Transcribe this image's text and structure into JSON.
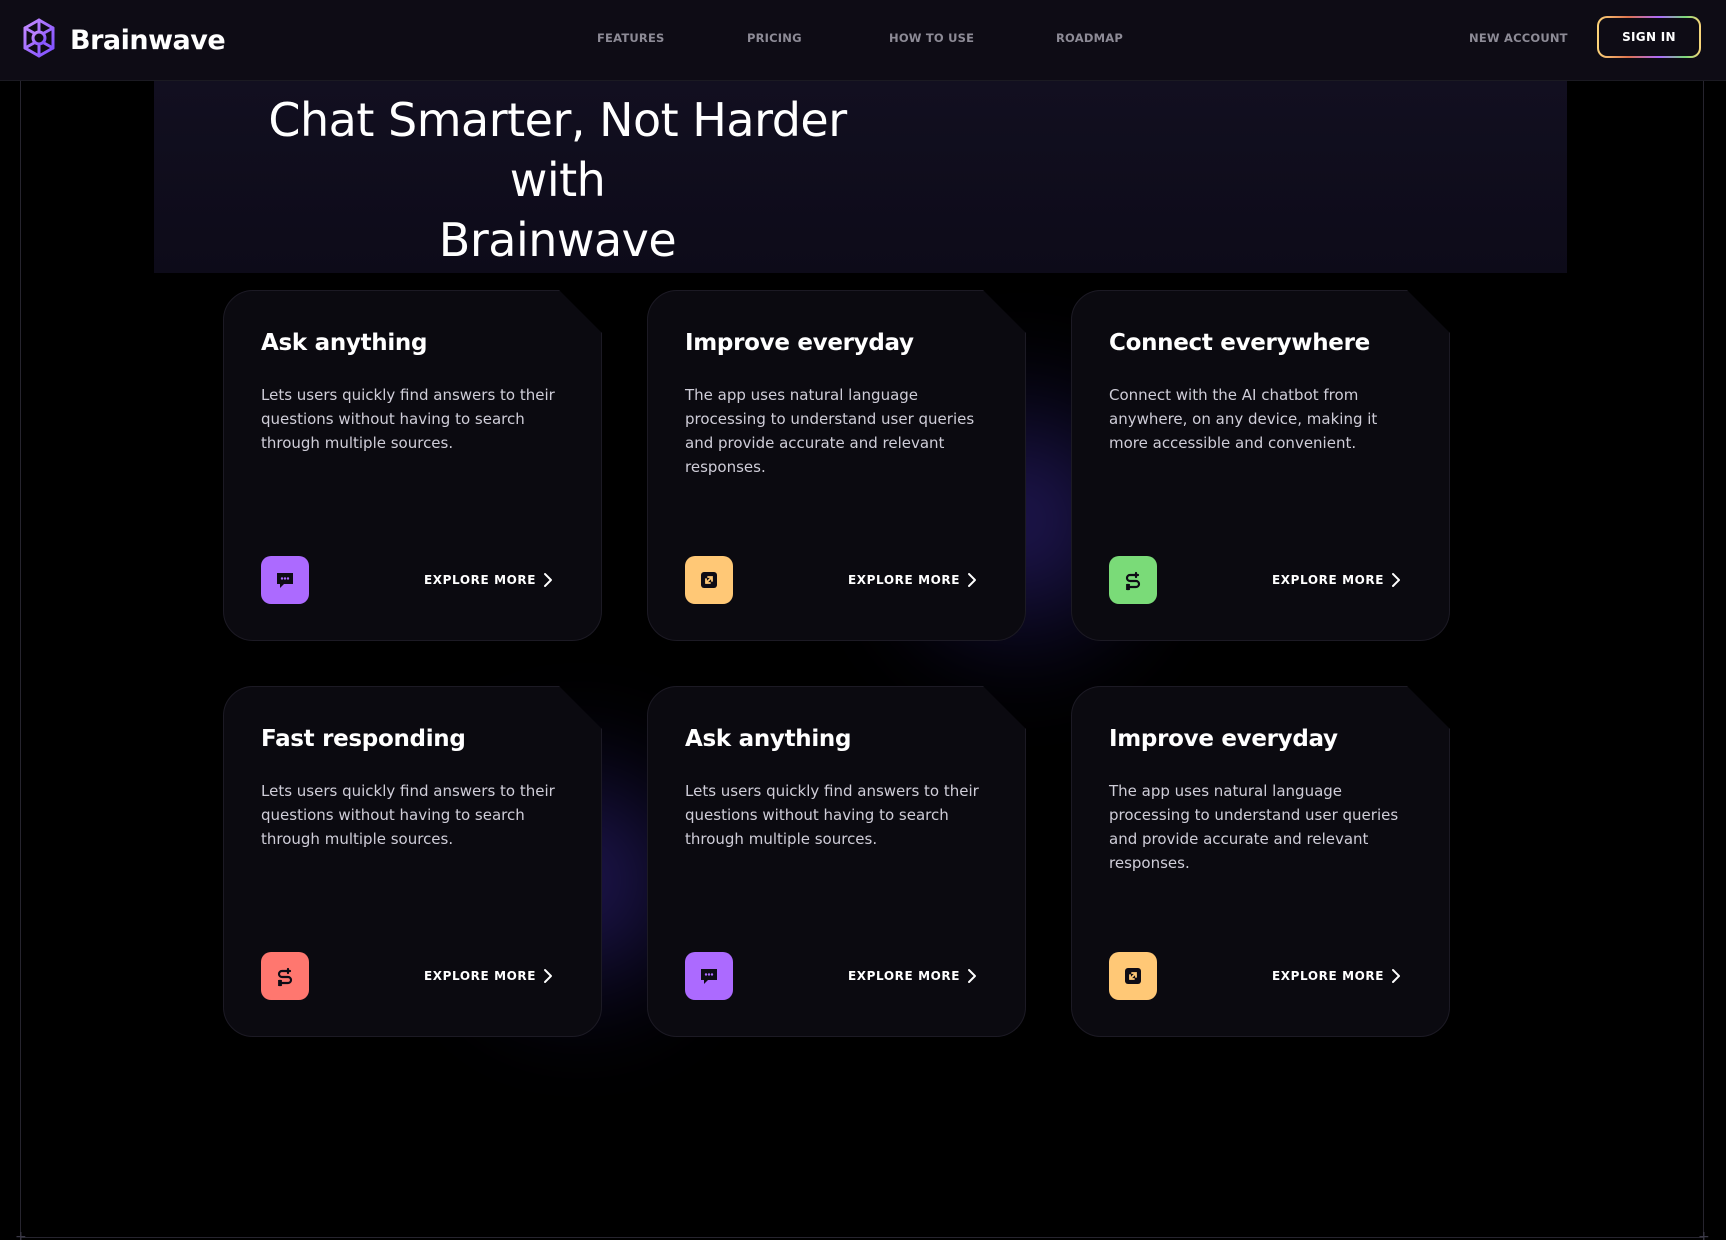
{
  "brand": {
    "name": "Brainwave",
    "logo_icon": "brain-icon"
  },
  "nav": {
    "items": [
      "FEATURES",
      "PRICING",
      "HOW TO USE",
      "ROADMAP"
    ],
    "new_account": "NEW ACCOUNT",
    "sign_in": "SIGN IN"
  },
  "hero": {
    "title_line1": "Chat Smarter, Not Harder with",
    "title_line2": "Brainwave"
  },
  "colors": {
    "purple": "#ac6aff",
    "yellow": "#ffc876",
    "green": "#7adb78",
    "red": "#ff776f",
    "background": "#000000",
    "header": "#0e0c15"
  },
  "cards": [
    {
      "title": "Ask anything",
      "text": "Lets users quickly find answers to their questions without having to search through multiple sources.",
      "icon": "chat-bubble-icon",
      "icon_color": "#ac6aff",
      "cta": "EXPLORE MORE"
    },
    {
      "title": "Improve everyday",
      "text": "The app uses natural language processing to understand user queries and provide accurate and relevant responses.",
      "icon": "expand-icon",
      "icon_color": "#ffc876",
      "cta": "EXPLORE MORE"
    },
    {
      "title": "Connect everywhere",
      "text": "Connect with the AI chatbot from anywhere, on any device, making it more accessible and convenient.",
      "icon": "connector-icon",
      "icon_color": "#7adb78",
      "cta": "EXPLORE MORE"
    },
    {
      "title": "Fast responding",
      "text": "Lets users quickly find answers to their questions without having to search through multiple sources.",
      "icon": "connector-icon",
      "icon_color": "#ff776f",
      "cta": "EXPLORE MORE"
    },
    {
      "title": "Ask anything",
      "text": "Lets users quickly find answers to their questions without having to search through multiple sources.",
      "icon": "chat-bubble-icon",
      "icon_color": "#ac6aff",
      "cta": "EXPLORE MORE"
    },
    {
      "title": "Improve everyday",
      "text": "The app uses natural language processing to understand user queries and provide accurate and relevant responses.",
      "icon": "expand-icon",
      "icon_color": "#ffc876",
      "cta": "EXPLORE MORE"
    }
  ]
}
